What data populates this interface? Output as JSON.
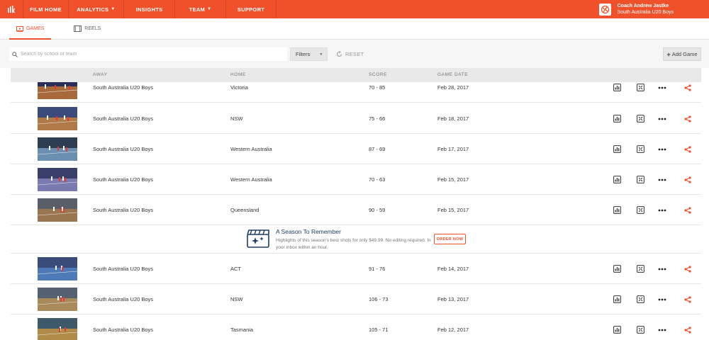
{
  "nav": {
    "items": [
      {
        "label": "FILM HOME",
        "caret": false
      },
      {
        "label": "ANALYTICS",
        "caret": true
      },
      {
        "label": "INSIGHTS",
        "caret": false
      },
      {
        "label": "TEAM",
        "caret": true
      },
      {
        "label": "SUPPORT",
        "caret": false
      }
    ],
    "user_name": "Coach Andrew Jastke",
    "user_team": "South Australia U20 Boys"
  },
  "tabs": {
    "games": "GAMES",
    "reels": "REELS"
  },
  "toolbar": {
    "search_placeholder": "Search by school or team",
    "filters_label": "Filters",
    "reset_label": "RESET",
    "add_game_label": "Add Game"
  },
  "table": {
    "headers": {
      "away": "AWAY",
      "home": "HOME",
      "score": "SCORE",
      "date": "GAME DATE"
    },
    "rows": [
      {
        "away": "South Australia U20 Boys",
        "home": "Victoria",
        "score": "70 - 85",
        "date": "Feb 28, 2017"
      },
      {
        "away": "South Australia U20 Boys",
        "home": "NSW",
        "score": "75 - 66",
        "date": "Feb 18, 2017"
      },
      {
        "away": "South Australia U20 Boys",
        "home": "Western Australia",
        "score": "87 - 69",
        "date": "Feb 17, 2017"
      },
      {
        "away": "South Australia U20 Boys",
        "home": "Western Australia",
        "score": "70 - 63",
        "date": "Feb 15, 2017"
      },
      {
        "away": "South Australia U20 Boys",
        "home": "Queensland",
        "score": "90 - 59",
        "date": "Feb 15, 2017"
      },
      {
        "away": "South Australia U20 Boys",
        "home": "ACT",
        "score": "91 - 76",
        "date": "Feb 14, 2017"
      },
      {
        "away": "South Australia U20 Boys",
        "home": "NSW",
        "score": "106 - 73",
        "date": "Feb 13, 2017"
      },
      {
        "away": "South Australia U20 Boys",
        "home": "Tasmania",
        "score": "105 - 71",
        "date": "Feb 12, 2017"
      }
    ]
  },
  "promo": {
    "title": "A Season To Remember",
    "text": "Highlights of this season's best shots for only $49.99. No editing required. In your inbox within an hour.",
    "button": "ORDER NOW"
  },
  "colors": {
    "brand": "#f0512b",
    "promo_title": "#1d3c63"
  },
  "icons": {
    "row_actions": [
      "stats-icon",
      "film-icon",
      "more-icon",
      "share-icon"
    ]
  }
}
